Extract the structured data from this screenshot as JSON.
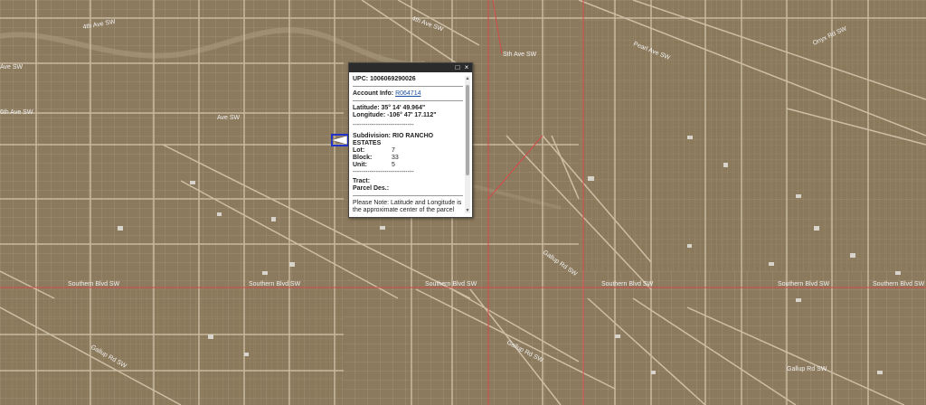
{
  "map": {
    "road_labels": [
      {
        "text": "4th Ave SW"
      },
      {
        "text": "4th Ave SW"
      },
      {
        "text": "6th Ave SW"
      },
      {
        "text": "Sth Ave SW"
      },
      {
        "text": "Ave SW"
      },
      {
        "text": "Ave SW"
      },
      {
        "text": "Pearl Ave SW"
      },
      {
        "text": "Onyx Rd SW"
      },
      {
        "text": "Southern Blvd SW"
      },
      {
        "text": "Southern Blvd SW"
      },
      {
        "text": "Southern Blvd SW"
      },
      {
        "text": "Southern Blvd SW"
      },
      {
        "text": "Southern Blvd SW"
      },
      {
        "text": "Southern Blvd SW"
      },
      {
        "text": "Gallup Rd SW"
      },
      {
        "text": "Gallup Rd SW"
      },
      {
        "text": "Gallup Rd SW"
      },
      {
        "text": "Gallup Rd SW"
      }
    ],
    "colors": {
      "ground": "#8c7a5e",
      "parcel_line": "#c9bba0",
      "main_road": "#d64a4a",
      "highlight": "#2233cc"
    }
  },
  "popup": {
    "upc_label": "UPC:",
    "upc_value": "1006069290026",
    "account_label": "Account Info:",
    "account_value": "R064714",
    "latitude_label": "Latitude:",
    "latitude_value": "35° 14' 49.964\"",
    "longitude_label": "Longitude:",
    "longitude_value": "-106° 47' 17.112\"",
    "divider": "-----------------------------",
    "subdivision_label": "Subdivision:",
    "subdivision_value": "RIO RANCHO ESTATES",
    "lot_label": "Lot:",
    "lot_value": "7",
    "block_label": "Block:",
    "block_value": "33",
    "unit_label": "Unit:",
    "unit_value": "5",
    "divider2": "-----------------------------",
    "tract_label": "Tract:",
    "parcel_label": "Parcel Des.:",
    "note": "Please Note: Latitude and Longitude is the approximate center of the parcel shown.",
    "maximize_icon": "□",
    "close_icon": "×"
  }
}
